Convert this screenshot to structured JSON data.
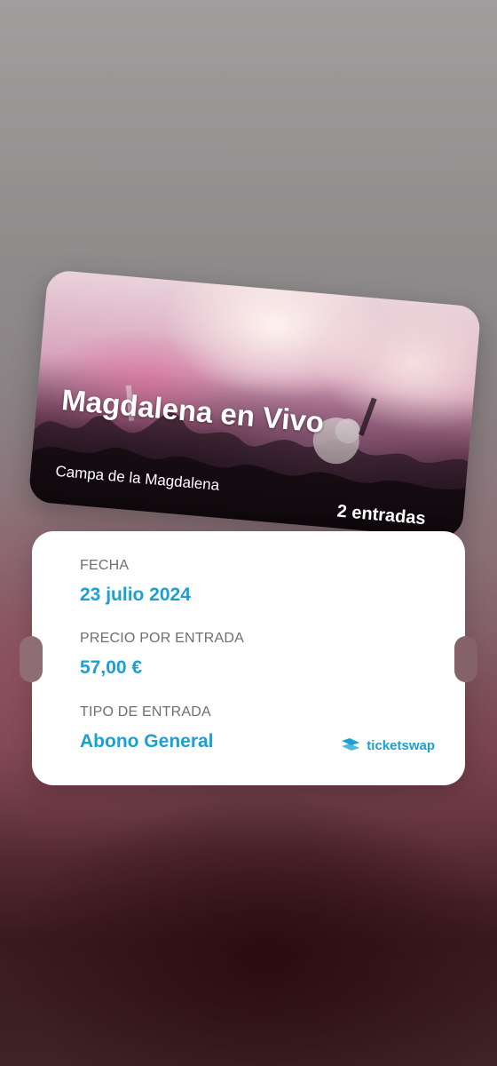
{
  "ticket": {
    "title": "Magdalena en Vivo",
    "venue": "Campa de la Magdalena",
    "count": "2 entradas"
  },
  "details": {
    "date_label": "FECHA",
    "date_value": "23 julio 2024",
    "price_label": "PRECIO POR ENTRADA",
    "price_value": "57,00 €",
    "type_label": "TIPO DE ENTRADA",
    "type_value": "Abono General"
  },
  "brand": {
    "name": "ticketswap",
    "icon": "ticketswap-logo-icon"
  },
  "colors": {
    "accent": "#1aa0d4",
    "label": "#6e6e73",
    "card": "#ffffff"
  }
}
